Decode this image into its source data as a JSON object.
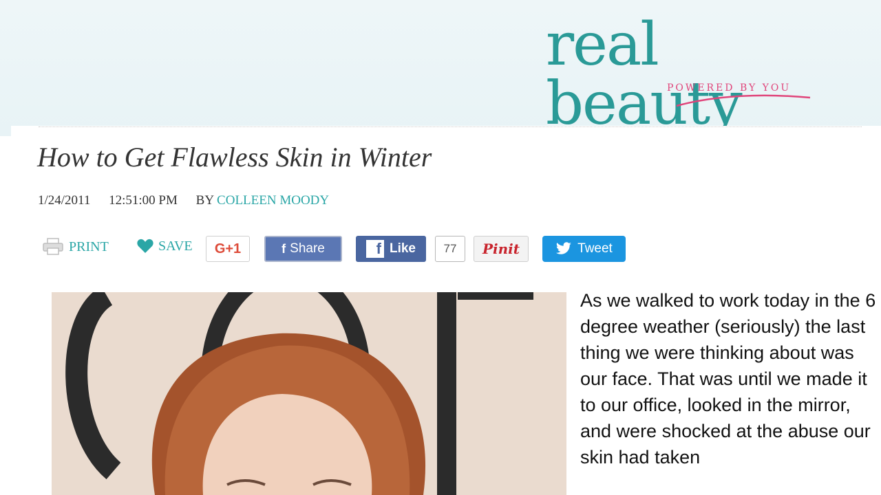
{
  "brand": {
    "name": "real beauty",
    "tagline": "POWERED BY YOU",
    "colors": {
      "teal": "#2a9a97",
      "pink": "#e0447a"
    }
  },
  "article": {
    "title": "How to Get Flawless Skin in Winter",
    "date": "1/24/2011",
    "time": "12:51:00 PM",
    "by_label": "BY",
    "author": "COLLEEN MOODY",
    "body": "As we walked to work today in the 6 degree weather (seriously) the last thing we were thinking about was our face. That was until we made it to our office, looked in the mirror, and were shocked at the abuse our skin had taken"
  },
  "actions": {
    "print_label": "PRINT",
    "save_label": "SAVE",
    "gplus_label": "G+1",
    "share_label": "Share",
    "like_label": "Like",
    "like_count": "77",
    "pinit_label": "Pinit",
    "tweet_label": "Tweet"
  },
  "icons": [
    "printer-icon",
    "heart-icon",
    "facebook-icon",
    "twitter-bird-icon"
  ]
}
